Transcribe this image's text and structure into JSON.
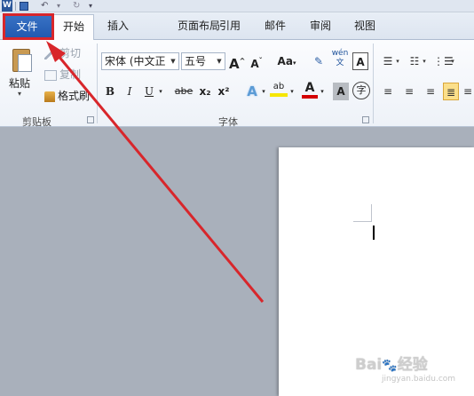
{
  "qat": {
    "word_logo": "W",
    "icons": [
      "word-logo-icon",
      "save-icon",
      "undo-icon",
      "redo-icon",
      "customize-qat-icon"
    ]
  },
  "tabs": {
    "file": "文件",
    "home": "开始",
    "insert": "插入",
    "page_layout": "页面布局",
    "references": "引用",
    "mailings": "邮件",
    "review": "审阅",
    "view": "视图"
  },
  "clipboard": {
    "paste": "粘贴",
    "cut": "剪切",
    "copy": "复制",
    "format_painter": "格式刷",
    "group_label": "剪贴板"
  },
  "font": {
    "font_name": "宋体 (中文正",
    "font_size": "五号",
    "grow": "A",
    "shrink": "A",
    "change_case": "Aa",
    "bold": "B",
    "italic": "I",
    "underline": "U",
    "strike": "abe",
    "subscript": "x₂",
    "superscript": "x²",
    "text_effect": "A",
    "highlight": "ab",
    "font_color": "A",
    "char_shading": "A",
    "enclose": "字",
    "group_label": "字体"
  },
  "colors": {
    "file_tab": "#2a63b8",
    "annotation": "#d8262b",
    "highlight_yellow": "#f6e600",
    "font_red": "#d40000"
  },
  "watermark": {
    "brand": "Bai",
    "brand_suffix": "经验",
    "url": "jingyan.baidu.com"
  }
}
